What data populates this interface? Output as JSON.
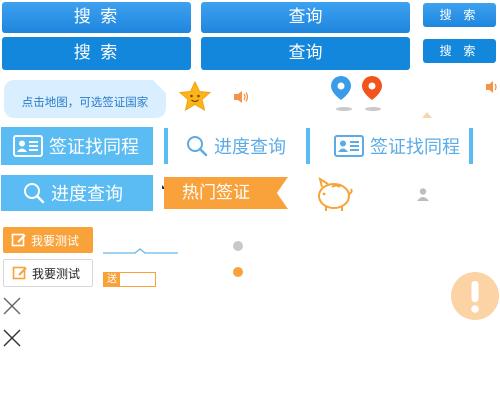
{
  "buttons": {
    "search_label": "搜 索",
    "query_label": "查询",
    "search_small_label": "搜 索"
  },
  "map_hint": "点击地图，可选签证国家",
  "actions": {
    "find_visa": "签证找同程",
    "progress": "进度查询"
  },
  "hot_visa": "热门签证",
  "test_label": "我要测试",
  "send_tag": "送",
  "colors": {
    "blue": "#1387db",
    "light_blue": "#5bbcf4",
    "orange": "#f8a239",
    "red_pin": "#f2541b"
  }
}
